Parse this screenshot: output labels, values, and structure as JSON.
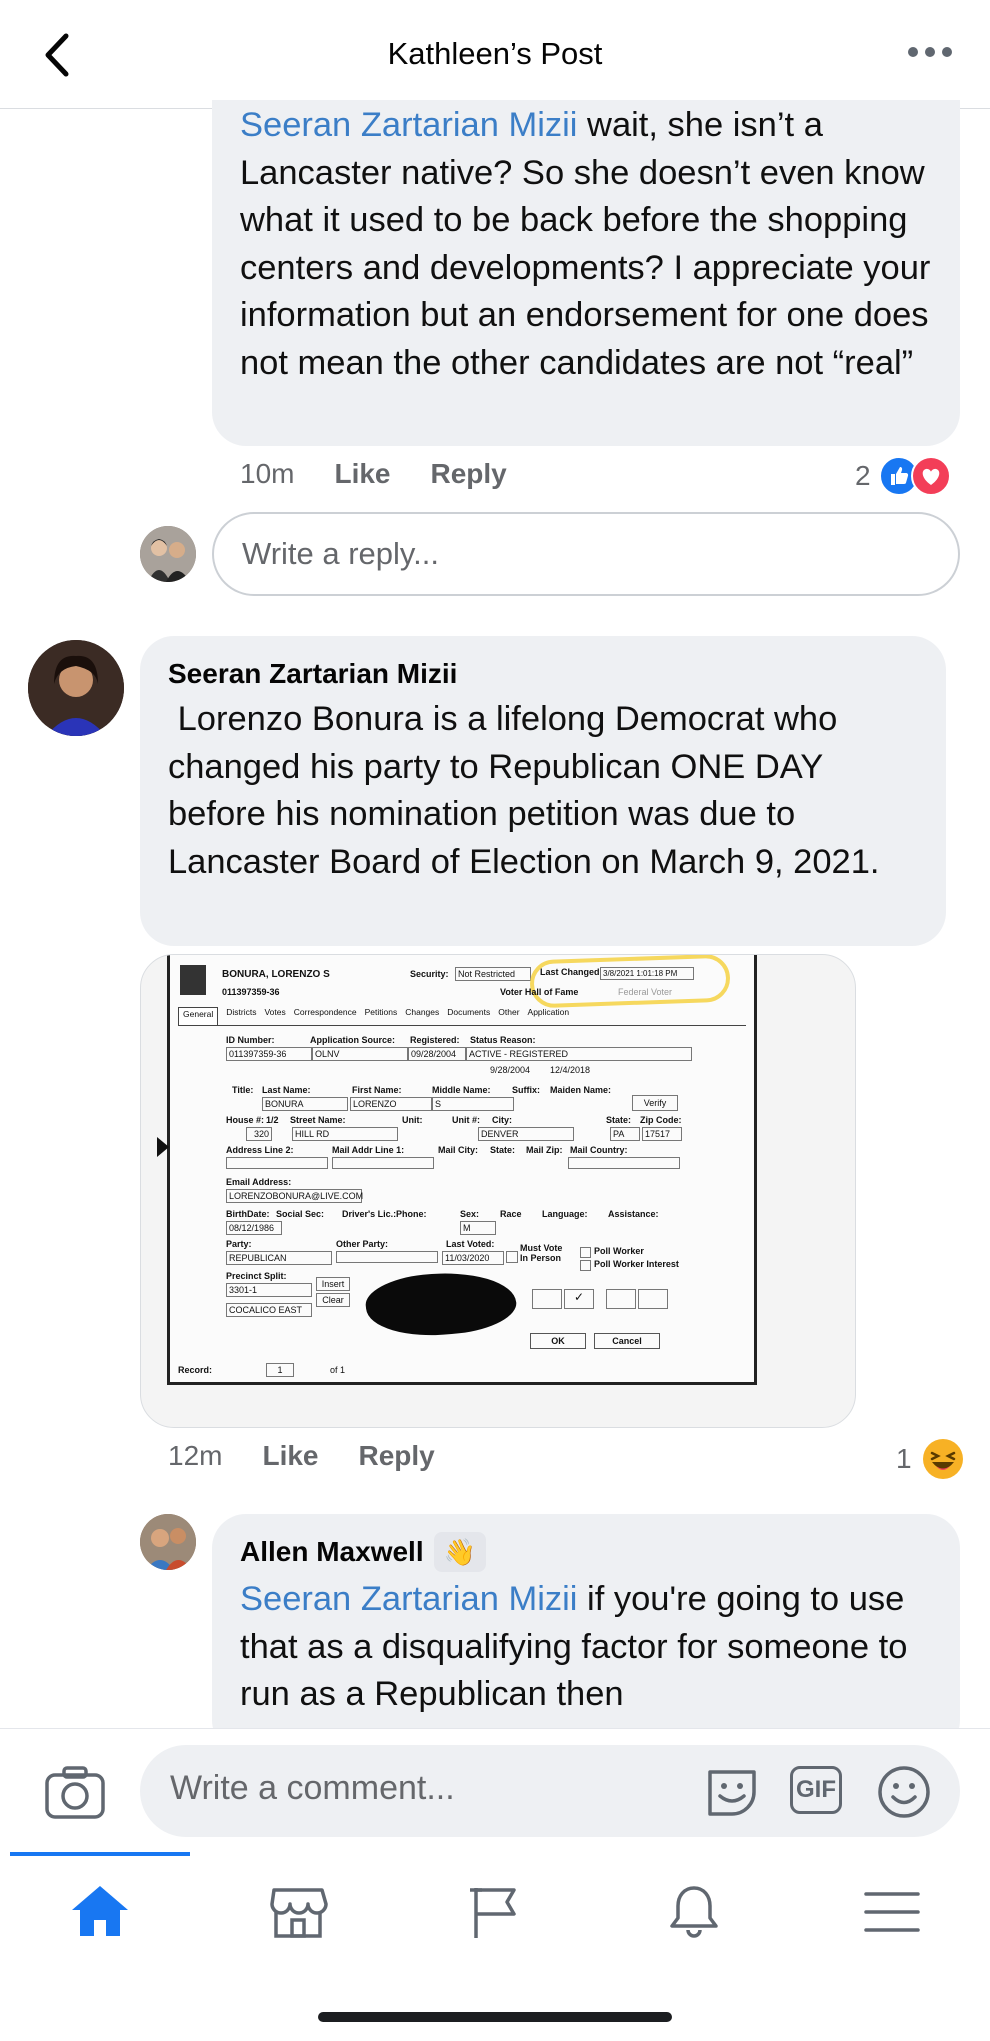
{
  "header": {
    "title": "Kathleen’s Post"
  },
  "reply1": {
    "mention": "Seeran Zartarian Mizii",
    "text": " wait, she isn’t a Lancaster native? So she doesn’t even know what it used to be back before the shopping centers and developments? I appreciate your information but an endorsement for one does not mean the other candidates are not “real”",
    "time": "10m",
    "like": "Like",
    "reply": "Reply",
    "reaction_count": "2"
  },
  "reply_box": {
    "placeholder": "Write a reply..."
  },
  "comment2": {
    "author": "Seeran Zartarian Mizii",
    "text": " Lorenzo Bonura is a lifelong Democrat who changed his party to Republican ONE DAY before his nomination petition was due to Lancaster Board of Election on March 9, 2021.",
    "time": "12m",
    "like": "Like",
    "reply": "Reply",
    "reaction_count": "1"
  },
  "document": {
    "heading": "BONURA, LORENZO S",
    "id": "011397359-36",
    "security_label": "Security:",
    "security_value": "Not Restricted",
    "last_changed_label": "Last Changed",
    "last_changed_value": "3/8/2021 1:01:18 PM",
    "voter_hall": "Voter Hall of Fame",
    "federal": "Federal Voter",
    "tabs": [
      "General",
      "Districts",
      "Votes",
      "Correspondence",
      "Petitions",
      "Changes",
      "Documents",
      "Other",
      "Application"
    ],
    "id_number_label": "ID Number:",
    "application_source_label": "Application Source:",
    "registered_label": "Registered:",
    "status_label": "Status Reason:",
    "id_number": "011397359-36",
    "application_source": "OLNV",
    "registered": "09/28/2004",
    "status": "ACTIVE - REGISTERED",
    "date1": "9/28/2004",
    "date2": "12/4/2018",
    "title_label": "Title:",
    "last_name_label": "Last Name:",
    "first_name_label": "First Name:",
    "middle_label": "Middle Name:",
    "suffix_label": "Suffix:",
    "maiden_label": "Maiden Name:",
    "last_name": "BONURA",
    "first_name": "LORENZO",
    "middle": "S",
    "verify": "Verify",
    "house_label": "House #:",
    "half_label": "1/2",
    "street_label": "Street Name:",
    "unit_label": "Unit:",
    "unit2_label": "Unit #:",
    "city_label": "City:",
    "state_label": "State:",
    "zip_label": "Zip Code:",
    "house": "320",
    "street": "HILL RD",
    "city": "DENVER",
    "state": "PA",
    "zip": "17517",
    "addr2_label": "Address Line 2:",
    "mail1_label": "Mail Addr Line 1:",
    "mailcity_label": "Mail City:",
    "mailstate_label": "State:",
    "mailzip_label": "Mail Zip:",
    "mailcountry_label": "Mail Country:",
    "email_label": "Email Address:",
    "email": "LORENZOBONURA@LIVE.COM",
    "birth_label": "BirthDate:",
    "ssn_label": "Social Sec:",
    "dl_label": "Driver's Lic.:",
    "phone_label": "Phone:",
    "sex_label": "Sex:",
    "race_label": "Race",
    "lang_label": "Language:",
    "assist_label": "Assistance:",
    "birth": "08/12/1986",
    "sex": "M",
    "party_label": "Party:",
    "other_party_label": "Other Party:",
    "last_voted_label": "Last Voted:",
    "must_vote": "Must Vote In Person",
    "party": "REPUBLICAN",
    "last_voted": "11/03/2020",
    "poll_worker": "Poll Worker",
    "poll_worker_interest": "Poll Worker Interest",
    "precinct_label": "Precinct Split:",
    "precinct": "3301-1",
    "precinct_name": "COCALICO EAST",
    "insert": "Insert",
    "clear": "Clear",
    "ok": "OK",
    "cancel": "Cancel",
    "record_label": "Record:",
    "record_num": "1",
    "record_of": "of 1"
  },
  "comment3": {
    "author": "Allen Maxwell",
    "mention": "Seeran Zartarian Mizii",
    "text": " if you're going to use that as a disqualifying factor for someone to run as a Republican then"
  },
  "composer": {
    "placeholder": "Write a comment...",
    "gif": "GIF"
  },
  "colors": {
    "link": "#3b7ec7",
    "bubble": "#eef0f3",
    "active_tab": "#1877f2",
    "like_blue": "#1877f2",
    "love_red": "#f33e58"
  }
}
